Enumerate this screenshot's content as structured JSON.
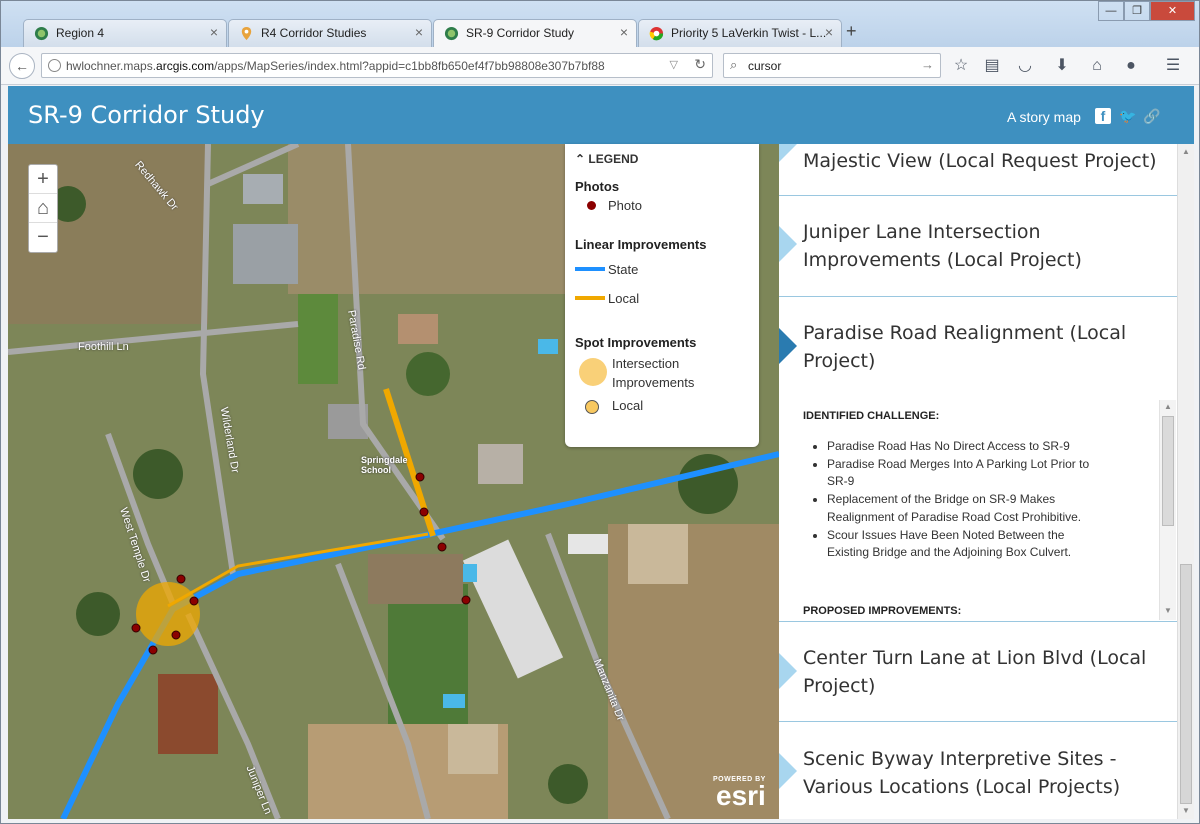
{
  "browser": {
    "tabs": [
      {
        "title": "Region 4"
      },
      {
        "title": "R4 Corridor Studies"
      },
      {
        "title": "SR-9 Corridor Study"
      },
      {
        "title": "Priority 5 LaVerkin Twist - L..."
      }
    ],
    "new_tab": "+",
    "close_glyph": "×",
    "url_prefix": "hwlochner.maps.",
    "url_domain": "arcgis.com",
    "url_rest": "/apps/MapSeries/index.html?appid=c1bb8fb650ef4f7bb98808e307b7bf88",
    "search_value": "cursor"
  },
  "header": {
    "title": "SR-9 Corridor Study",
    "story_label": "A story map"
  },
  "map": {
    "street_labels": [
      "Redhawk Dr",
      "Foothill Ln",
      "Paradise Rd",
      "Wilderland Dr",
      "West Temple Dr",
      "Manzanita Dr",
      "Juniper Ln"
    ],
    "place_label": "Springdale School",
    "powered_by": "POWERED BY",
    "esri": "esri"
  },
  "legend": {
    "title": "LEGEND",
    "photos_heading": "Photos",
    "photo_label": "Photo",
    "linear_heading": "Linear Improvements",
    "state_label": "State",
    "local_label": "Local",
    "spot_heading": "Spot Improvements",
    "intersection_label": "Intersection Improvements",
    "spot_local_label": "Local",
    "colors": {
      "state": "#1e90ff",
      "local": "#f0a800",
      "intersection": "#f8c860",
      "photo": "#8b0000"
    }
  },
  "panel": {
    "entries": [
      {
        "title": "Majestic View (Local Request Project)"
      },
      {
        "title": "Juniper Lane Intersection Improvements (Local Project)"
      },
      {
        "title": "Paradise Road Realignment (Local Project)"
      },
      {
        "title": "Center Turn Lane at Lion Blvd (Local Project)"
      },
      {
        "title": "Scenic Byway Interpretive Sites - Various Locations (Local Projects)"
      }
    ],
    "challenge_heading": "IDENTIFIED CHALLENGE:",
    "challenges": [
      "Paradise Road Has No Direct Access to SR-9",
      "Paradise Road Merges Into A Parking Lot Prior to SR-9",
      "Replacement of the Bridge on SR-9 Makes Realignment of Paradise Road Cost Prohibitive.",
      "Scour Issues Have Been Noted Between the Existing Bridge and the Adjoining Box Culvert."
    ],
    "improvements_heading": "PROPOSED IMPROVEMENTS:"
  }
}
